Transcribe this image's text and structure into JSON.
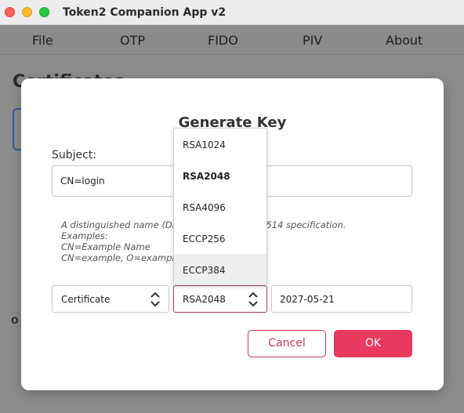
{
  "window": {
    "title": "Token2 Companion App v2"
  },
  "menu": {
    "items": [
      "File",
      "OTP",
      "FIDO",
      "PIV",
      "About"
    ]
  },
  "background": {
    "heading": "Certificates",
    "label_o": "o"
  },
  "dialog": {
    "title": "Generate Key",
    "subject_label": "Subject:",
    "subject_value": "CN=login",
    "help_lines": [
      "A distinguished name (DN) ... ce to the RFC 4514 specification.",
      "Examples:",
      "CN=Example Name",
      "CN=example, O=example."
    ],
    "type_select": {
      "value": "Certificate"
    },
    "algorithm_select": {
      "value": "RSA2048"
    },
    "expiry_date": "2027-05-21",
    "cancel_label": "Cancel",
    "ok_label": "OK",
    "algorithm_options": [
      "RSA1024",
      "RSA2048",
      "RSA4096",
      "ECCP256",
      "ECCP384"
    ],
    "selected_option": "RSA2048",
    "hovered_option": "ECCP384"
  },
  "colors": {
    "accent": "#e8395f",
    "accent_border": "#d0345a"
  }
}
